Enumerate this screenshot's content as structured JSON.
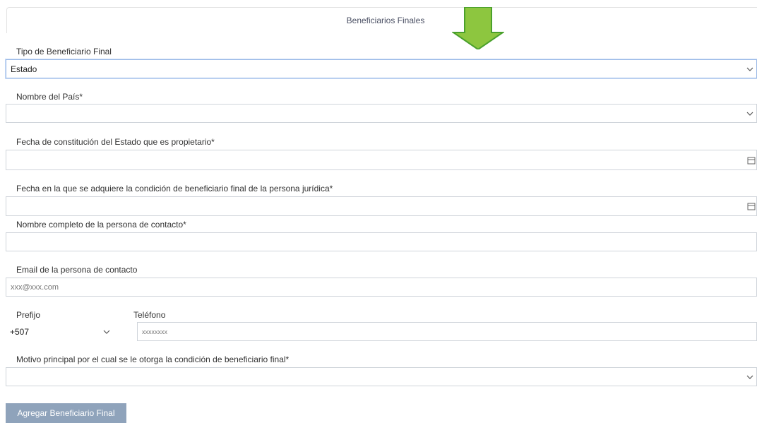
{
  "tab": {
    "title": "Beneficiarios Finales"
  },
  "fields": {
    "tipo": {
      "label": "Tipo de Beneficiario Final",
      "value": "Estado"
    },
    "pais": {
      "label": "Nombre del País*",
      "value": ""
    },
    "fecha_constitucion": {
      "label": "Fecha de constitución del Estado que es propietario*",
      "value": ""
    },
    "fecha_condicion": {
      "label": "Fecha en la que se adquiere la condición de beneficiario final de la persona jurídica*",
      "value": ""
    },
    "nombre_contacto": {
      "label": "Nombre completo de la persona de contacto*",
      "value": ""
    },
    "email_contacto": {
      "label": "Email de la persona de contacto",
      "placeholder": "xxx@xxx.com"
    },
    "prefijo": {
      "label": "Prefijo",
      "value": "+507"
    },
    "telefono": {
      "label": "Teléfono",
      "placeholder": "xxxxxxxx"
    },
    "motivo": {
      "label": "Motivo principal por el cual se le otorga la condición de beneficiario final*",
      "value": ""
    }
  },
  "actions": {
    "add_label": "Agregar Beneficiario Final"
  },
  "colors": {
    "arrow_fill": "#8dc63f",
    "arrow_stroke": "#4aa02c",
    "button_bg": "#8fa3bb",
    "focus_border": "#9ab8e6"
  },
  "icons": {
    "select": "chevron-down-icon",
    "date": "calendar-icon",
    "annotation": "arrow-down-icon"
  }
}
